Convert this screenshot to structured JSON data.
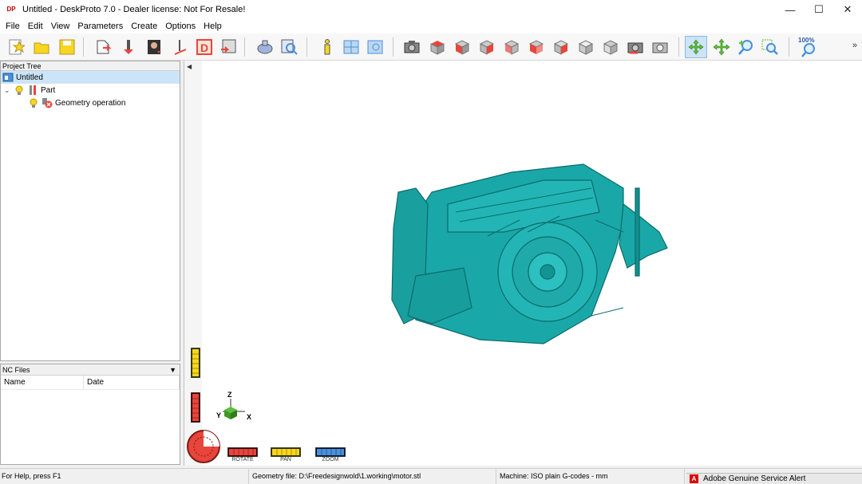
{
  "window": {
    "title": "Untitled - DeskProto 7.0 - Dealer license: Not For Resale!",
    "logo_text": "DP",
    "minimize": "—",
    "maximize": "☐",
    "close": "✕"
  },
  "menu": [
    "File",
    "Edit",
    "View",
    "Parameters",
    "Create",
    "Options",
    "Help"
  ],
  "toolbar": {
    "zoom_badge": "100%",
    "more": "»",
    "colors": {
      "part_red": "#e8453c",
      "grey": "#b8b8b8",
      "yellow": "#f7d61f",
      "blue": "#4a90d9",
      "green": "#5fbf3a"
    }
  },
  "project_tree": {
    "header": "Project Tree",
    "items": [
      {
        "label": "Untitled"
      },
      {
        "label": "Part"
      },
      {
        "label": "Geometry operation"
      }
    ]
  },
  "nc_files": {
    "header": "NC Files",
    "columns": [
      "Name",
      "Date"
    ]
  },
  "viewport": {
    "model_color": "#1aa7a7",
    "axes": {
      "x": "X",
      "y": "Y",
      "z": "Z"
    },
    "gauges": {
      "rotate": "ROTATE",
      "pan": "PAN",
      "zoom": "ZOOM"
    }
  },
  "status": {
    "help": "For Help, press F1",
    "geometry": "Geometry file: D:\\Freedesignwold\\1.working\\motor.stl",
    "machine": "Machine: ISO plain G-codes - mm"
  },
  "alert": {
    "icon": "A",
    "text": "Adobe Genuine Service Alert"
  }
}
